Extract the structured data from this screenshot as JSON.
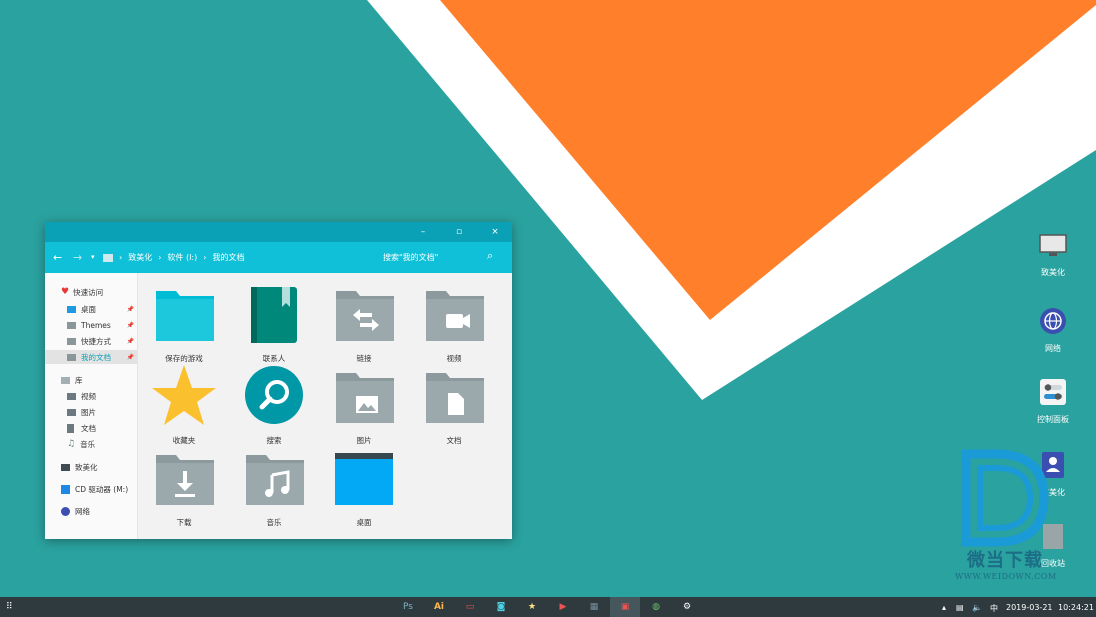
{
  "window": {
    "controls": {
      "minimize": "–",
      "maximize": "▫",
      "close": "×"
    },
    "breadcrumb": [
      "致美化",
      "软件 (I:)",
      "我的文档"
    ],
    "search_placeholder": "搜索\"我的文档\"",
    "sidebar": {
      "quick_access": "快速访问",
      "pinned": [
        "桌面",
        "Themes",
        "快捷方式",
        "我的文档"
      ],
      "library": "库",
      "library_items": [
        "视频",
        "图片",
        "文档",
        "音乐"
      ],
      "this_pc": "致美化",
      "cd_drive": "CD 驱动器 (M:)",
      "network": "网络"
    },
    "folders": [
      "保存的游戏",
      "联系人",
      "链接",
      "视频",
      "收藏夹",
      "搜索",
      "图片",
      "文档",
      "下载",
      "音乐",
      "桌面"
    ]
  },
  "desktop_icons": [
    "致美化",
    "网络",
    "控制面板",
    "致美化",
    "回收站"
  ],
  "watermark": {
    "text": "微当下载",
    "url": "WWW.WEIDOWN.COM"
  },
  "taskbar": {
    "apps": [
      "Ps",
      "Ai",
      "",
      "",
      "",
      "",
      "",
      "",
      "",
      ""
    ],
    "tray_lang": "中",
    "date": "2019-03-21",
    "time": "10:24:21"
  },
  "colors": {
    "accent": "#0fc0d8",
    "titlebar": "#0aa0b6",
    "desktop": "#2aa29f",
    "orange": "#ff7f2a",
    "taskbar": "#2f3a3f"
  }
}
